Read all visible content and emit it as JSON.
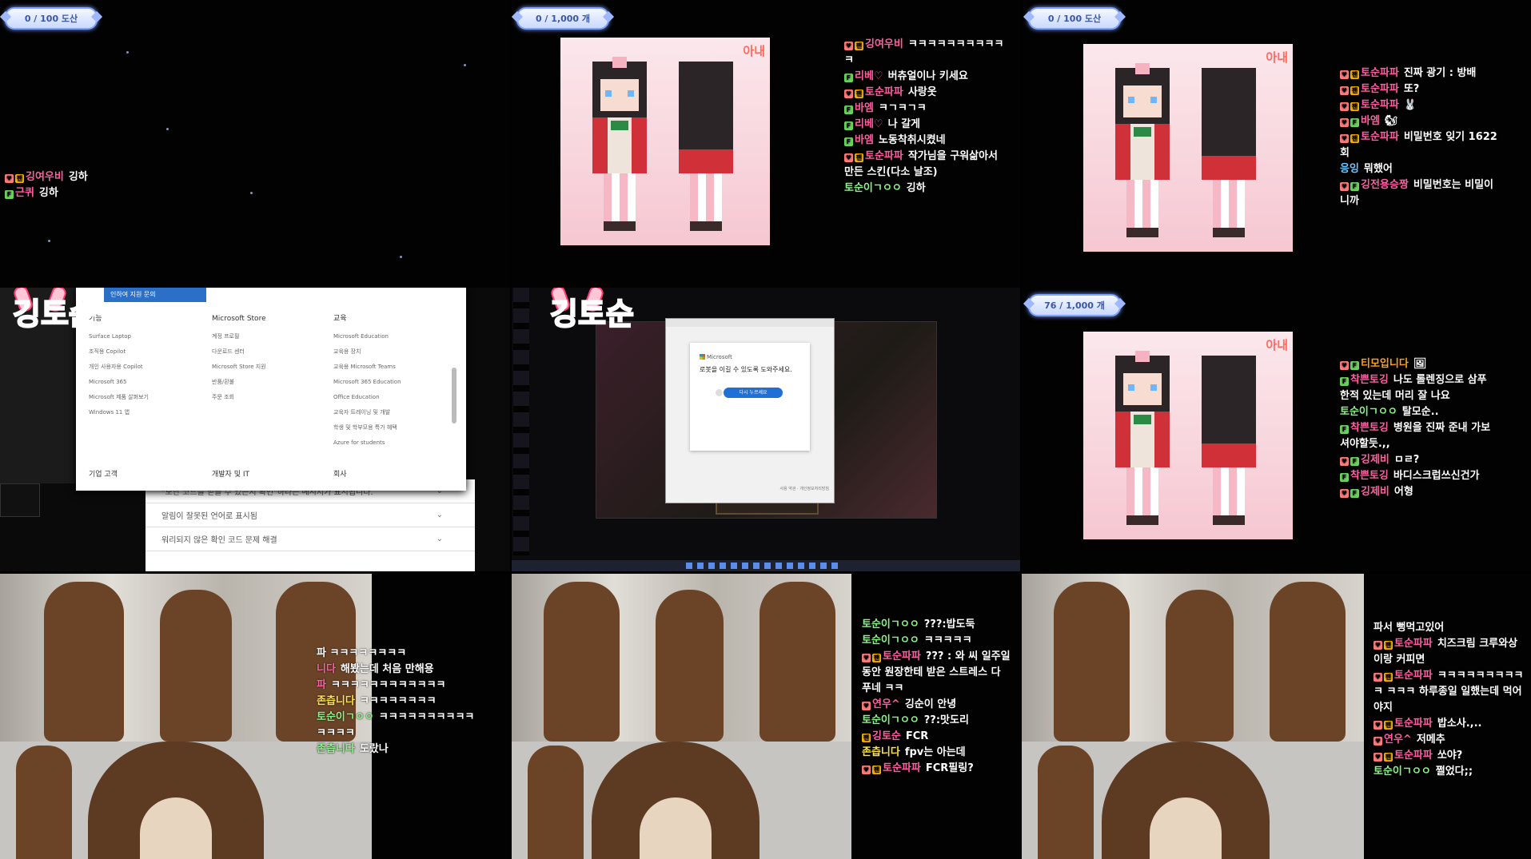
{
  "gauges": [
    {
      "text": "0 / 100 도산"
    },
    {
      "text": "0 / 1,000 개"
    },
    {
      "text": "0 / 100 도산"
    },
    {
      "text": "76 / 1,000 개"
    }
  ],
  "skin_tag": "아내",
  "logo_text": "깅토순",
  "chat_a": [
    {
      "badges": [
        "h",
        "g"
      ],
      "nick": "깅여우비",
      "nick_color": "#ff5fa2",
      "text": "깅하"
    },
    {
      "badges": [
        "f"
      ],
      "nick": "근퀴",
      "nick_color": "#ff5fa2",
      "text": "깅하"
    }
  ],
  "chat_b": [
    {
      "badges": [
        "h",
        "g"
      ],
      "nick": "깅여우비",
      "nick_color": "#ff5fa2",
      "text": "ㅋㅋㅋㅋㅋㅋㅋㅋㅋㅋㅋ"
    },
    {
      "badges": [
        "f"
      ],
      "nick": "리베♡",
      "nick_color": "#ff5fa2",
      "text": "버츄얼이나 키세요"
    },
    {
      "badges": [
        "h",
        "g"
      ],
      "nick": "토순파파",
      "nick_color": "#ff5fa2",
      "text": "사랑옷"
    },
    {
      "badges": [
        "f"
      ],
      "nick": "바엠",
      "nick_color": "#ff5fa2",
      "text": "ㅋㄱㅋㄱㅋ"
    },
    {
      "badges": [
        "f"
      ],
      "nick": "리베♡",
      "nick_color": "#ff5fa2",
      "text": "나 갈게"
    },
    {
      "badges": [
        "f"
      ],
      "nick": "바엠",
      "nick_color": "#ff5fa2",
      "text": "노동착취시켰네"
    },
    {
      "badges": [
        "h",
        "g"
      ],
      "nick": "토순파파",
      "nick_color": "#ff5fa2",
      "text": "작가님을 구워삶아서 만든 스킨(다소 날조)"
    },
    {
      "badges": [],
      "nick": "토순이ㄱㅇㅇ",
      "nick_color": "#8ef18a",
      "text": "깅하"
    }
  ],
  "chat_c": [
    {
      "badges": [
        "h",
        "g"
      ],
      "nick": "토순파파",
      "nick_color": "#ff5fa2",
      "text": "진짜 광기 : 방배"
    },
    {
      "badges": [
        "h",
        "g"
      ],
      "nick": "토순파파",
      "nick_color": "#ff5fa2",
      "text": "또?"
    },
    {
      "badges": [
        "h",
        "g"
      ],
      "nick": "토순파파",
      "nick_color": "#ff5fa2",
      "text": "🐰"
    },
    {
      "badges": [
        "h",
        "f"
      ],
      "nick": "바엠",
      "nick_color": "#ff5fa2",
      "text": "🐿"
    },
    {
      "badges": [
        "h",
        "g"
      ],
      "nick": "토순파파",
      "nick_color": "#ff5fa2",
      "text": "비밀번호 잊기 1622회"
    },
    {
      "badges": [],
      "nick": "응잉",
      "nick_color": "#6fc6ff",
      "text": "뭐했어"
    },
    {
      "badges": [
        "h",
        "f"
      ],
      "nick": "깅전용승짱",
      "nick_color": "#ff5fa2",
      "text": "비밀번호는 비밀이니까"
    }
  ],
  "chat_d": [
    {
      "badges": [
        "h",
        "f"
      ],
      "nick": "티모입니다",
      "nick_color": "#ff9f1c",
      "text": "🖼"
    },
    {
      "badges": [
        "f"
      ],
      "nick": "착쁜토깅",
      "nick_color": "#ff5fa2",
      "text": "나도 롤렌징으로 삼푸 한적 있는데 머리 잘 나요"
    },
    {
      "badges": [],
      "nick": "토순이ㄱㅇㅇ",
      "nick_color": "#8ef18a",
      "text": "탈모순.."
    },
    {
      "badges": [
        "f"
      ],
      "nick": "착쁜토깅",
      "nick_color": "#ff5fa2",
      "text": "병원을 진짜 준내 가보셔야할듯.,,"
    },
    {
      "badges": [
        "h",
        "f"
      ],
      "nick": "깅제비",
      "nick_color": "#ff5fa2",
      "text": "ㅁㄹ?"
    },
    {
      "badges": [
        "f"
      ],
      "nick": "착쁜토깅",
      "nick_color": "#ff5fa2",
      "text": "바디스크럽쓰신건가"
    },
    {
      "badges": [
        "h",
        "f"
      ],
      "nick": "깅제비",
      "nick_color": "#ff5fa2",
      "text": "어형"
    }
  ],
  "chat_e": [
    {
      "badges": [],
      "nick": "",
      "nick_color": "#ff5fa2",
      "text": "파 ㅋㅋㅋㅋㅋㅋㅋㅋ"
    },
    {
      "badges": [],
      "nick": "니다",
      "nick_color": "#ff5fa2",
      "text": "해봤는데 처음 만해용"
    },
    {
      "badges": [],
      "nick": "파",
      "nick_color": "#ff5fa2",
      "text": "ㅋㅋㅋㅋㅋㅋㅋㅋㅋㅋㅋㅋ"
    },
    {
      "badges": [],
      "nick": "존츱니다",
      "nick_color": "#ffe14d",
      "text": "ㅋㅋㅋㅋㅋㅋㅋㅋ"
    },
    {
      "badges": [],
      "nick": "토순이ㄱㅇㅇ",
      "nick_color": "#8ef18a",
      "text": "ㅋㅋㅋㅋㅋㅋㅋㅋㅋㅋㅋㅋㅋㅋ"
    },
    {
      "badges": [],
      "nick": "존츱니다",
      "nick_color": "#8ef18a",
      "text": "도랐나"
    }
  ],
  "chat_f": [
    {
      "badges": [],
      "nick": "토순이ㄱㅇㅇ",
      "nick_color": "#8ef18a",
      "text": "???:밥도둑"
    },
    {
      "badges": [],
      "nick": "토순이ㄱㅇㅇ",
      "nick_color": "#8ef18a",
      "text": "ㅋㅋㅋㅋㅋ"
    },
    {
      "badges": [
        "h",
        "g"
      ],
      "nick": "토순파파",
      "nick_color": "#ff5fa2",
      "text": "??? : 와 씨 일주일 동안 원장한테 받은 스트레스 다 푸네 ㅋㅋ"
    },
    {
      "badges": [
        "h"
      ],
      "nick": "연우^",
      "nick_color": "#ff5fa2",
      "text": "깅순이 안녕"
    },
    {
      "badges": [],
      "nick": "토순이ㄱㅇㅇ",
      "nick_color": "#8ef18a",
      "text": "??:맛도리"
    },
    {
      "badges": [
        "g"
      ],
      "nick": "깅토순",
      "nick_color": "#ff5fa2",
      "text": "FCR"
    },
    {
      "badges": [],
      "nick": "존츱니다",
      "nick_color": "#ffe14d",
      "text": "fpv는 아는데"
    },
    {
      "badges": [
        "h",
        "g"
      ],
      "nick": "토순파파",
      "nick_color": "#ff5fa2",
      "text": "FCR필링?"
    }
  ],
  "chat_g": [
    {
      "badges": [],
      "nick": "",
      "nick_color": "#ff5fa2",
      "text": "파서 뻥먹고있어"
    },
    {
      "badges": [
        "h",
        "g"
      ],
      "nick": "토순파파",
      "nick_color": "#ff5fa2",
      "text": "치즈크림 크루와상이랑 커피면"
    },
    {
      "badges": [
        "h",
        "g"
      ],
      "nick": "토순파파",
      "nick_color": "#ff5fa2",
      "text": "ㅋㅋㅋㅋㅋㅋㅋㅋㅋㅋ ㅋㅋㅋ 하루종일 일했는데 먹어야지"
    },
    {
      "badges": [
        "h",
        "g"
      ],
      "nick": "토순파파",
      "nick_color": "#ff5fa2",
      "text": "밥소사.,.."
    },
    {
      "badges": [
        "h"
      ],
      "nick": "연우^",
      "nick_color": "#ff5fa2",
      "text": "저메추"
    },
    {
      "badges": [
        "h",
        "g"
      ],
      "nick": "토순파파",
      "nick_color": "#ff5fa2",
      "text": "쏘야?"
    },
    {
      "badges": [],
      "nick": "토순이ㄱㅇㅇ",
      "nick_color": "#8ef18a",
      "text": "쩔었다;;"
    }
  ],
  "ms_support": {
    "tab": "인하여 지원 문의",
    "col1_title": "기능",
    "col1_items": [
      "Surface Laptop",
      "조직용 Copilot",
      "개인 사용자용 Copilot",
      "Microsoft 365",
      "Microsoft 제품 살펴보기",
      "Windows 11 앱"
    ],
    "col2_title": "Microsoft Store",
    "col2_items": [
      "계정 프로필",
      "다운로드 센터",
      "Microsoft Store 지원",
      "반품/환불",
      "주문 조회"
    ],
    "col3_title": "교육",
    "col3_items": [
      "Microsoft Education",
      "교육용 장치",
      "교육용 Microsoft Teams",
      "Microsoft 365 Education",
      "Office Education",
      "교육자 트레이닝 및 개발",
      "학생 및 학부모용 특가 혜택",
      "Azure for students"
    ],
    "foot1": "기업 고객",
    "foot2": "개발자 및 IT",
    "foot3": "회사",
    "accordion": [
      "\"보안 코드를 받을 수 있는지 확인\"하라는 메시지가 표시됩니다.",
      "알림이 잘못된 언어로 표시됨",
      "워리되지 않은 확인 코드 문제 해결"
    ]
  },
  "ms_dialog": {
    "brand": "Microsoft",
    "message": "로봇을 이길 수 있도록 도와주세요.",
    "button": "다시 누르세요",
    "footer": "사용 약관 · 개인정보처리방침"
  }
}
